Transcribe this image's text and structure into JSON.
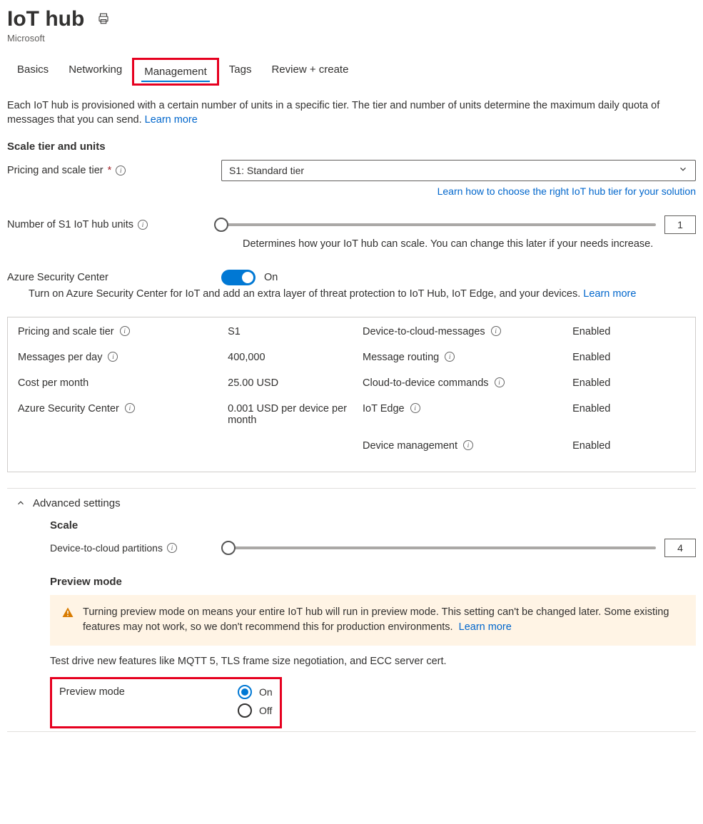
{
  "header": {
    "title": "IoT hub",
    "subtitle": "Microsoft"
  },
  "tabs": {
    "basics": "Basics",
    "networking": "Networking",
    "management": "Management",
    "tags": "Tags",
    "review": "Review + create"
  },
  "intro": {
    "text": "Each IoT hub is provisioned with a certain number of units in a specific tier. The tier and number of units determine the maximum daily quota of messages that you can send.",
    "learn_more": "Learn more"
  },
  "scale": {
    "heading": "Scale tier and units",
    "pricing_label": "Pricing and scale tier",
    "pricing_value": "S1: Standard tier",
    "tier_link": "Learn how to choose the right IoT hub tier for your solution",
    "units_label": "Number of S1 IoT hub units",
    "units_value": "1",
    "units_help": "Determines how your IoT hub can scale. You can change this later if your needs increase."
  },
  "asc": {
    "label": "Azure Security Center",
    "state": "On",
    "desc": "Turn on Azure Security Center for IoT and add an extra layer of threat protection to IoT Hub, IoT Edge, and your devices.",
    "learn_more": "Learn more"
  },
  "summary": {
    "left": [
      {
        "label": "Pricing and scale tier",
        "value": "S1",
        "info": true
      },
      {
        "label": "Messages per day",
        "value": "400,000",
        "info": true
      },
      {
        "label": "Cost per month",
        "value": "25.00 USD",
        "info": false
      },
      {
        "label": "Azure Security Center",
        "value": "0.001 USD per device per month",
        "info": true
      }
    ],
    "right": [
      {
        "label": "Device-to-cloud-messages",
        "value": "Enabled",
        "info": true
      },
      {
        "label": "Message routing",
        "value": "Enabled",
        "info": true
      },
      {
        "label": "Cloud-to-device commands",
        "value": "Enabled",
        "info": true
      },
      {
        "label": "IoT Edge",
        "value": "Enabled",
        "info": true
      },
      {
        "label": "Device management",
        "value": "Enabled",
        "info": true
      }
    ]
  },
  "advanced": {
    "heading": "Advanced settings",
    "scale_heading": "Scale",
    "partitions_label": "Device-to-cloud partitions",
    "partitions_value": "4",
    "preview_heading": "Preview mode",
    "preview_warning": "Turning preview mode on means your entire IoT hub will run in preview mode. This setting can't be changed later. Some existing features may not work, so we don't recommend this for production environments.",
    "preview_learn_more": "Learn more",
    "preview_desc": "Test drive new features like MQTT 5, TLS frame size negotiation, and ECC server cert.",
    "preview_label": "Preview mode",
    "preview_on": "On",
    "preview_off": "Off"
  }
}
